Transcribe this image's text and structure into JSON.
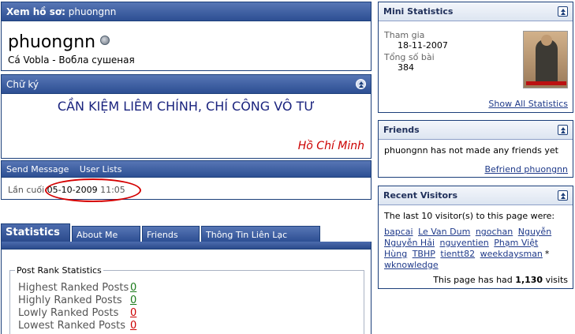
{
  "profile": {
    "header_label": "Xem hồ sơ:",
    "header_name": "phuongnn",
    "username": "phuongnn",
    "usertitle": "Cá Vobla - Вобла сушеная"
  },
  "signature": {
    "title": "Chữ ký",
    "text": "CẦN KIỆM LIÊM CHÍNH, CHÍ CÔNG VÔ TƯ",
    "author": "Hồ Chí Minh"
  },
  "actions": {
    "send_message": "Send Message",
    "user_lists": "User Lists",
    "last_visit_label": "Lần cuối",
    "last_visit_date": "05-10-2009",
    "last_visit_time": "11:05"
  },
  "tabs": [
    {
      "label": "Statistics"
    },
    {
      "label": "About Me"
    },
    {
      "label": "Friends"
    },
    {
      "label": "Thông Tin Liên Lạc"
    }
  ],
  "post_rank": {
    "legend": "Post Rank Statistics",
    "rows": [
      {
        "label": "Highest Ranked Posts",
        "value": "0"
      },
      {
        "label": "Highly Ranked Posts",
        "value": "0"
      },
      {
        "label": "Lowly Ranked Posts",
        "value": "0"
      },
      {
        "label": "Lowest Ranked Posts",
        "value": "0"
      }
    ],
    "colors": {
      "positive": "#1a7a1a",
      "negative": "#cc0000"
    }
  },
  "mini_stats": {
    "title": "Mini Statistics",
    "join_label": "Tham gia",
    "join_value": "18-11-2007",
    "posts_label": "Tổng số bài",
    "posts_value": "384",
    "show_all": "Show All Statistics"
  },
  "friends": {
    "title": "Friends",
    "text": "phuongnn has not made any friends yet",
    "befriend": "Befriend phuongnn"
  },
  "visitors": {
    "title": "Recent Visitors",
    "intro": "The last 10 visitor(s) to this page were:",
    "list": [
      "bapcai",
      "Le Van Dum",
      "ngochan",
      "Nguyễn",
      "Nguyễn Hải",
      "nguyentien",
      "Phạm Việt",
      "Hùng",
      "TBHP",
      "tientt82",
      "weekdaysman",
      "wknowledge"
    ],
    "count_prefix": "This page has had",
    "count_value": "1,130",
    "count_suffix": "visits"
  },
  "colors": {
    "header_blue": "#2d4f93",
    "link": "#1f3a8a",
    "highlight_red": "#d40000"
  }
}
